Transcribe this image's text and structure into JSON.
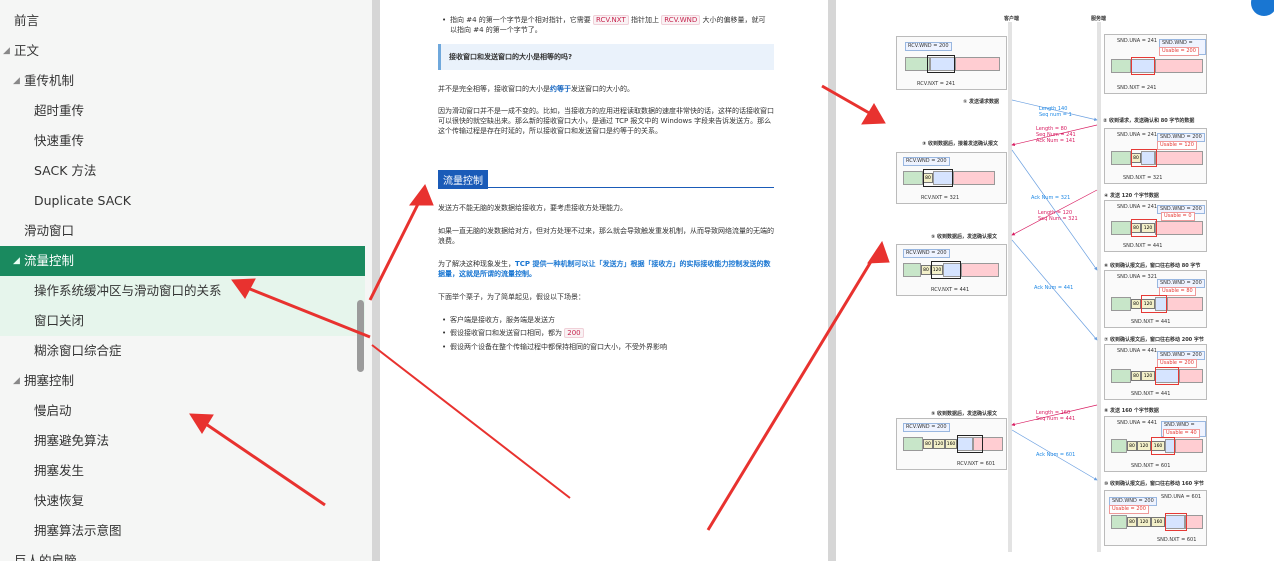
{
  "sidebar": {
    "items": [
      {
        "label": "前言",
        "indent": 14,
        "caret": false,
        "state": "normal"
      },
      {
        "label": "正文",
        "indent": 14,
        "caret": true,
        "state": "normal"
      },
      {
        "label": "重传机制",
        "indent": 24,
        "caret": true,
        "state": "normal"
      },
      {
        "label": "超时重传",
        "indent": 34,
        "caret": false,
        "state": "normal"
      },
      {
        "label": "快速重传",
        "indent": 34,
        "caret": false,
        "state": "normal"
      },
      {
        "label": "SACK 方法",
        "indent": 34,
        "caret": false,
        "state": "normal"
      },
      {
        "label": "Duplicate SACK",
        "indent": 34,
        "caret": false,
        "state": "normal"
      },
      {
        "label": "滑动窗口",
        "indent": 24,
        "caret": false,
        "state": "normal"
      },
      {
        "label": "流量控制",
        "indent": 24,
        "caret": true,
        "state": "selected"
      },
      {
        "label": "操作系统缓冲区与滑动窗口的关系",
        "indent": 34,
        "caret": false,
        "state": "highlight"
      },
      {
        "label": "窗口关闭",
        "indent": 34,
        "caret": false,
        "state": "highlight"
      },
      {
        "label": "糊涂窗口综合症",
        "indent": 34,
        "caret": false,
        "state": "normal"
      },
      {
        "label": "拥塞控制",
        "indent": 24,
        "caret": true,
        "state": "normal"
      },
      {
        "label": "慢启动",
        "indent": 34,
        "caret": false,
        "state": "normal"
      },
      {
        "label": "拥塞避免算法",
        "indent": 34,
        "caret": false,
        "state": "normal"
      },
      {
        "label": "拥塞发生",
        "indent": 34,
        "caret": false,
        "state": "normal"
      },
      {
        "label": "快速恢复",
        "indent": 34,
        "caret": false,
        "state": "normal"
      },
      {
        "label": "拥塞算法示意图",
        "indent": 34,
        "caret": false,
        "state": "normal"
      },
      {
        "label": "巨人的肩膀",
        "indent": 14,
        "caret": false,
        "state": "normal"
      }
    ]
  },
  "doc": {
    "bullet_top_a": "指向 #4 的第一个字节是个相对指针，它需要",
    "code_rcv_nxt": "RCV.NXT",
    "bullet_top_b": "指针加上",
    "code_rcv_wnd": "RCV.WND",
    "bullet_top_c": "大小的偏移量，就可以指向 #4 的第一个字节了。",
    "callout": "接收窗口和发送窗口的大小是相等的吗?",
    "p1_a": "并不是完全相等，接收窗口的大小是",
    "p1_em": "约等于",
    "p1_b": "发送窗口的大小的。",
    "p2": "因为滑动窗口并不是一成不变的。比如，当接收方的应用进程读取数据的速度非常快的话，这样的话接收窗口可以很快的就空缺出来。那么新的接收窗口大小，是通过 TCP 报文中的 Windows 字段来告诉发送方。那么这个传输过程是存在时延的，所以接收窗口和发送窗口是约等于的关系。",
    "heading": "流量控制",
    "p3": "发送方不能无脑的发数据给接收方，要考虑接收方处理能力。",
    "p4": "如果一直无脑的发数据给对方，但对方处理不过来，那么就会导致触发重发机制，从而导致网络流量的无端的浪费。",
    "p5_a": "为了解决这种现象发生，",
    "p5_b": "TCP 提供一种机制可以让「发送方」根据「接收方」的实际接收能力控制发送的数据量，这就是所谓的流量控制。",
    "p6": "下面举个栗子，为了简单起见，假设以下场景：",
    "li1": "客户端是接收方，服务端是发送方",
    "li2_a": "假设接收窗口和发送窗口相同，都为",
    "li2_code": "200",
    "li3": "假设两个设备在整个传输过程中都保持相同的窗口大小，不受外界影响"
  },
  "diagram": {
    "client_label": "客户端",
    "server_label": "服务端",
    "steps": {
      "s1": "① 发送请求数据",
      "s2": "② 收到请求，发送确认和 80 字节的数据",
      "s3": "③ 收到数据后，接着发送确认报文",
      "s4": "④ 发送 120 个字节数据",
      "s5": "⑤ 收到数据后，发送确认报文",
      "s6": "⑥ 收到确认报文后，窗口往右移动 80 字节",
      "s7": "⑦ 收到确认报文后，窗口往右移动 200 字节",
      "s8": "⑧ 发送 160 个字节数据",
      "s9": "⑨ 收到数据后，发送确认报文",
      "s10": "⑩ 收到确认报文后，窗口往右移动 160 字节"
    },
    "msgs": {
      "m1a": "Length 140",
      "m1b": "Seq num = 1",
      "m2a": "Length = 80",
      "m2b": "Seq Num = 241",
      "m2c": "Ack Num = 141",
      "m3": "Ack Num = 321",
      "m4a": "Length = 120",
      "m4b": "Seq Num = 321",
      "m5": "Ack Num = 441",
      "m6a": "Length = 160",
      "m6b": "Seq num = 441",
      "m7": "Ack Num = 601"
    },
    "client_boxes": {
      "b1_wnd": "RCV.WND = 200",
      "b1_nxt": "RCV.NXT = 241",
      "b2_wnd": "RCV.WND = 200",
      "b2_nxt": "RCV.NXT = 321",
      "b3_wnd": "RCV.WND = 200",
      "b3_nxt": "RCV.NXT = 441",
      "b4_wnd": "RCV.WND = 200",
      "b4_nxt": "RCV.NXT = 601"
    },
    "server_boxes": {
      "s1_una": "SND.UNA = 241",
      "s1_wnd": "SND.WND = 200",
      "s1_usable": "Usable = 200",
      "s1_nxt": "SND.NXT = 241",
      "s2_una": "SND.UNA = 241",
      "s2_wnd": "SND.WND = 200",
      "s2_usable": "Usable = 120",
      "s2_nxt": "SND.NXT = 321",
      "s3_una": "SND.UNA = 241",
      "s3_wnd": "SND.WND = 200",
      "s3_usable": "Usable = 0",
      "s3_nxt": "SND.NXT = 441",
      "s4_una": "SND.UNA = 321",
      "s4_wnd": "SND.WND = 200",
      "s4_usable": "Usable = 80",
      "s4_nxt": "SND.NXT = 441",
      "s5_una": "SND.UNA = 441",
      "s5_wnd": "SND.WND = 200",
      "s5_usable": "Usable = 200",
      "s5_nxt": "SND.NXT = 441",
      "s6_una": "SND.UNA = 441",
      "s6_wnd": "SND.WND = 200",
      "s6_usable": "Usable = 40",
      "s6_nxt": "SND.NXT = 601",
      "s7_una": "SND.UNA = 601",
      "s7_wnd": "SND.WND = 200",
      "s7_usable": "Usable = 200",
      "s7_nxt": "SND.NXT = 601"
    },
    "cells": {
      "c80": "80",
      "c120": "120",
      "c160": "160"
    }
  },
  "colors": {
    "selected": "#1a8a5f",
    "highlight": "#e6f5ec",
    "arrow_red": "#e8322f",
    "heading_blue": "#1a5bb8"
  }
}
